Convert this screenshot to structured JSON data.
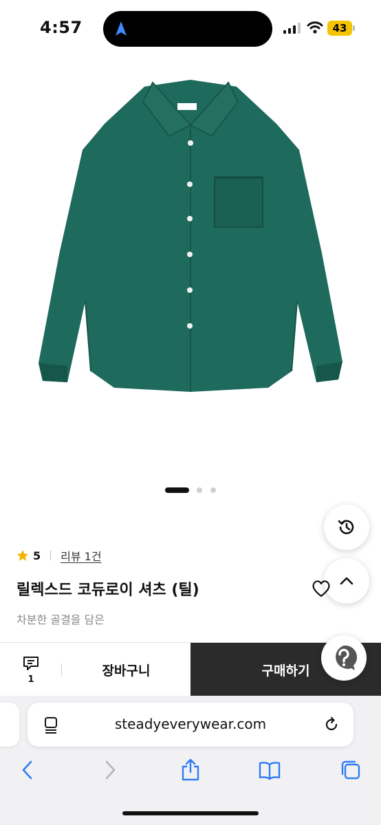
{
  "status_bar": {
    "time": "4:57",
    "battery": "43"
  },
  "product": {
    "image_icon": "teal-corduroy-shirt",
    "rating_score": "5",
    "review_link": "리뷰 1건",
    "title": "릴렉스드 코듀로이 셔츠 (틸)",
    "subtitle": "차분한 골결을 담은"
  },
  "carousel": {
    "current": 1,
    "total": 3
  },
  "purchase_bar": {
    "comment_count": "1",
    "cart_label": "장바구니",
    "buy_label": "구매하기"
  },
  "browser": {
    "url": "steadyeverywear.com"
  },
  "colors": {
    "shirt": "#1e6a5c",
    "buy_button_bg": "#2b2b2b",
    "star": "#f5b400",
    "browser_accent": "#2f7bf5"
  }
}
